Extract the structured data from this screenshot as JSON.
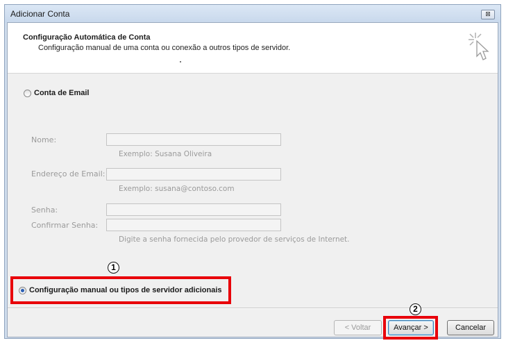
{
  "window": {
    "title": "Adicionar Conta",
    "close_symbol": "⊠"
  },
  "header": {
    "title": "Configuração Automática de Conta",
    "subtitle": "Configuração manual de uma conta ou conexão a outros tipos de servidor.",
    "icon": "wizard-cursor-icon"
  },
  "options": {
    "email_account": {
      "label": "Conta de Email",
      "selected": false
    },
    "manual_config": {
      "label": "Configuração manual ou tipos de servidor adicionais",
      "selected": true
    }
  },
  "form": {
    "name": {
      "label": "Nome:",
      "value": "",
      "hint": "Exemplo: Susana Oliveira"
    },
    "email": {
      "label": "Endereço de Email:",
      "value": "",
      "hint": "Exemplo: susana@contoso.com"
    },
    "password": {
      "label": "Senha:",
      "value": ""
    },
    "confirm_password": {
      "label": "Confirmar Senha:",
      "value": ""
    },
    "password_hint": "Digite a senha fornecida pelo provedor de serviços de Internet."
  },
  "annotations": {
    "step1": "1",
    "step2": "2",
    "highlight_color": "#e8000a"
  },
  "buttons": {
    "back": "< Voltar",
    "next": "Avançar >",
    "cancel": "Cancelar"
  }
}
